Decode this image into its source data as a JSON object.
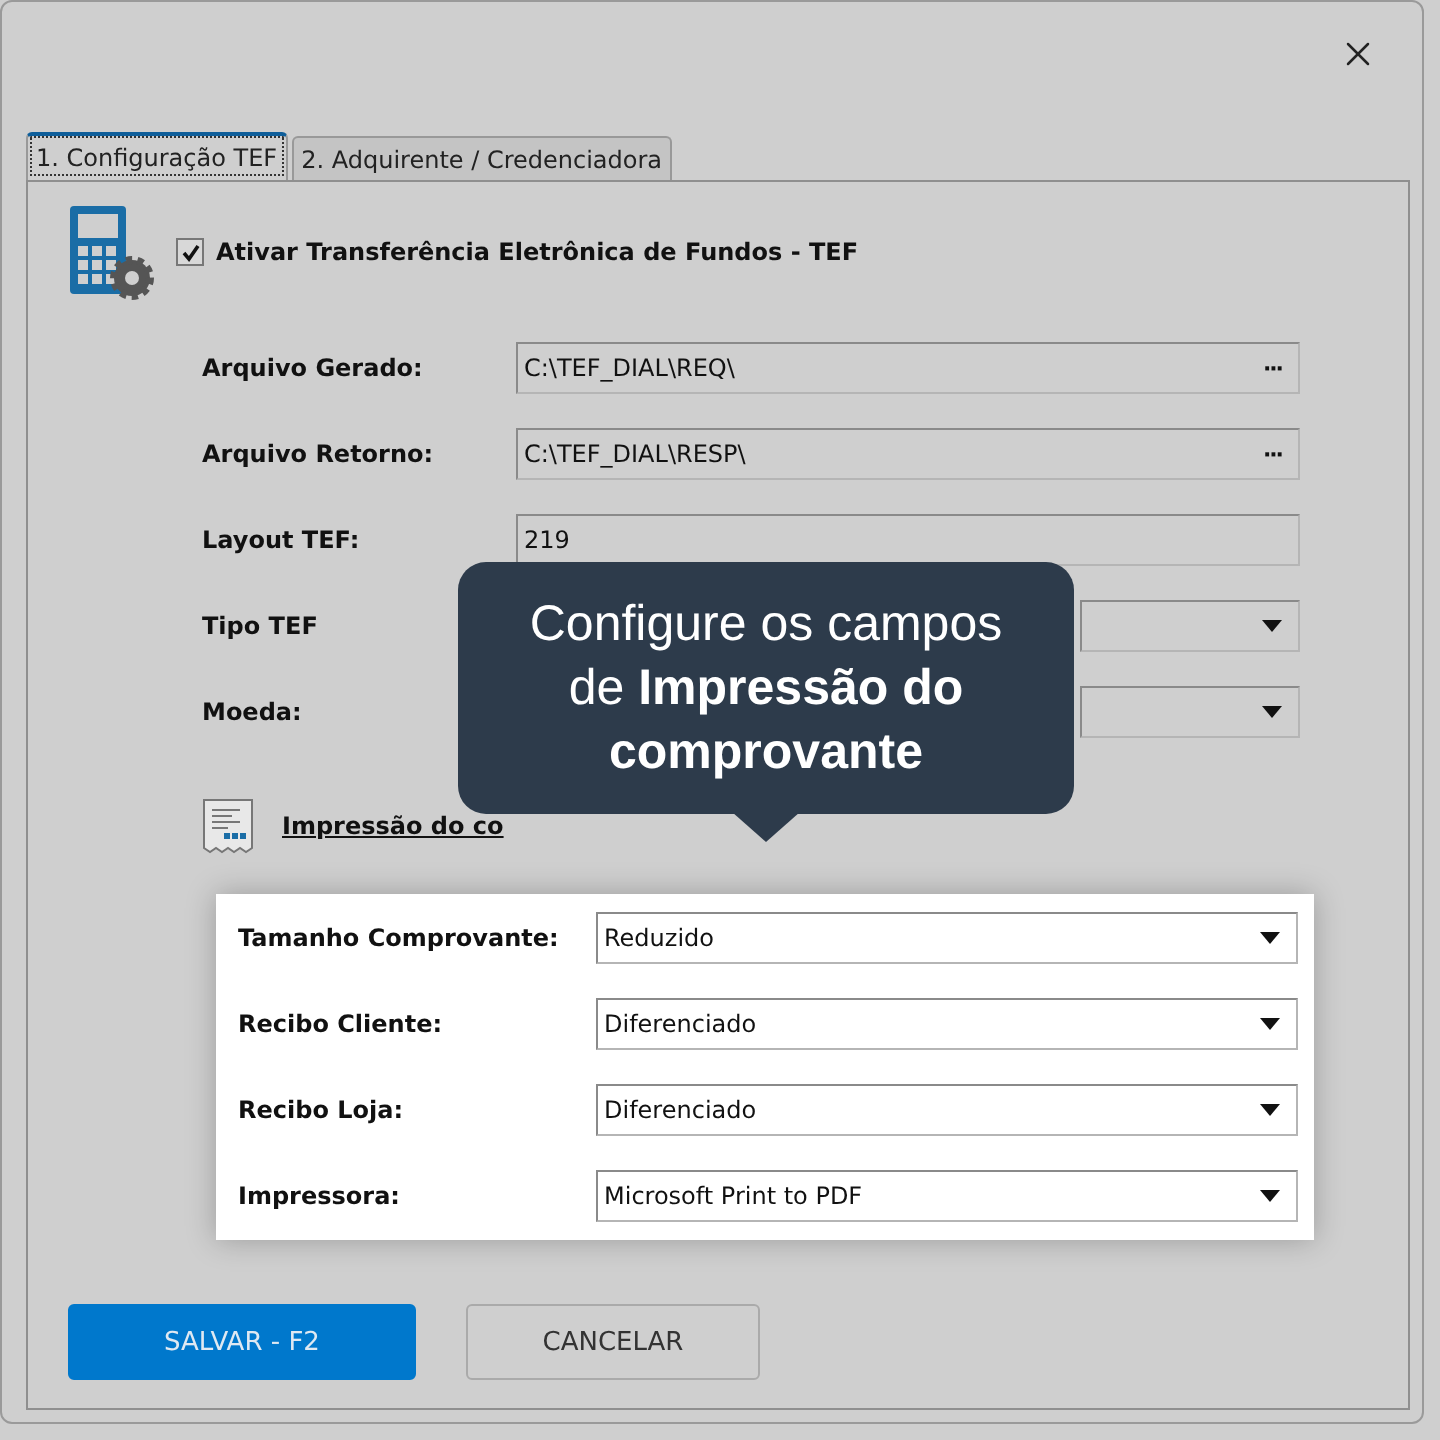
{
  "tabs": [
    {
      "label": "1. Configuração TEF",
      "selected": true
    },
    {
      "label": "2. Adquirente / Credenciadora",
      "selected": false
    }
  ],
  "enable_tef": {
    "label": "Ativar Transferência Eletrônica de Fundos - TEF",
    "checked": true
  },
  "fields": [
    {
      "kind": "path",
      "label": "Arquivo Gerado:",
      "value": "C:\\TEF_DIAL\\REQ\\",
      "button": "···"
    },
    {
      "kind": "path",
      "label": "Arquivo Retorno:",
      "value": "C:\\TEF_DIAL\\RESP\\",
      "button": "···"
    },
    {
      "kind": "text",
      "label": "Layout TEF:",
      "value": "219"
    },
    {
      "kind": "select",
      "label": "Tipo TEF"
    },
    {
      "kind": "select",
      "label": "Moeda:"
    }
  ],
  "receipt_section": {
    "link": "Impressão do co"
  },
  "receipt_settings": [
    {
      "label": "Tamanho Comprovante:",
      "value": "Reduzido"
    },
    {
      "label": "Recibo Cliente:",
      "value": "Diferenciado"
    },
    {
      "label": "Recibo Loja:",
      "value": "Diferenciado"
    },
    {
      "label": "Impressora:",
      "value": "Microsoft Print to PDF"
    }
  ],
  "tooltip": {
    "text": "Configure os campos de **Impressão do comprovante**"
  },
  "buttons": [
    {
      "kind": "primary",
      "label": "SALVAR - F2"
    },
    {
      "kind": "secondary",
      "label": "CANCELAR"
    }
  ]
}
